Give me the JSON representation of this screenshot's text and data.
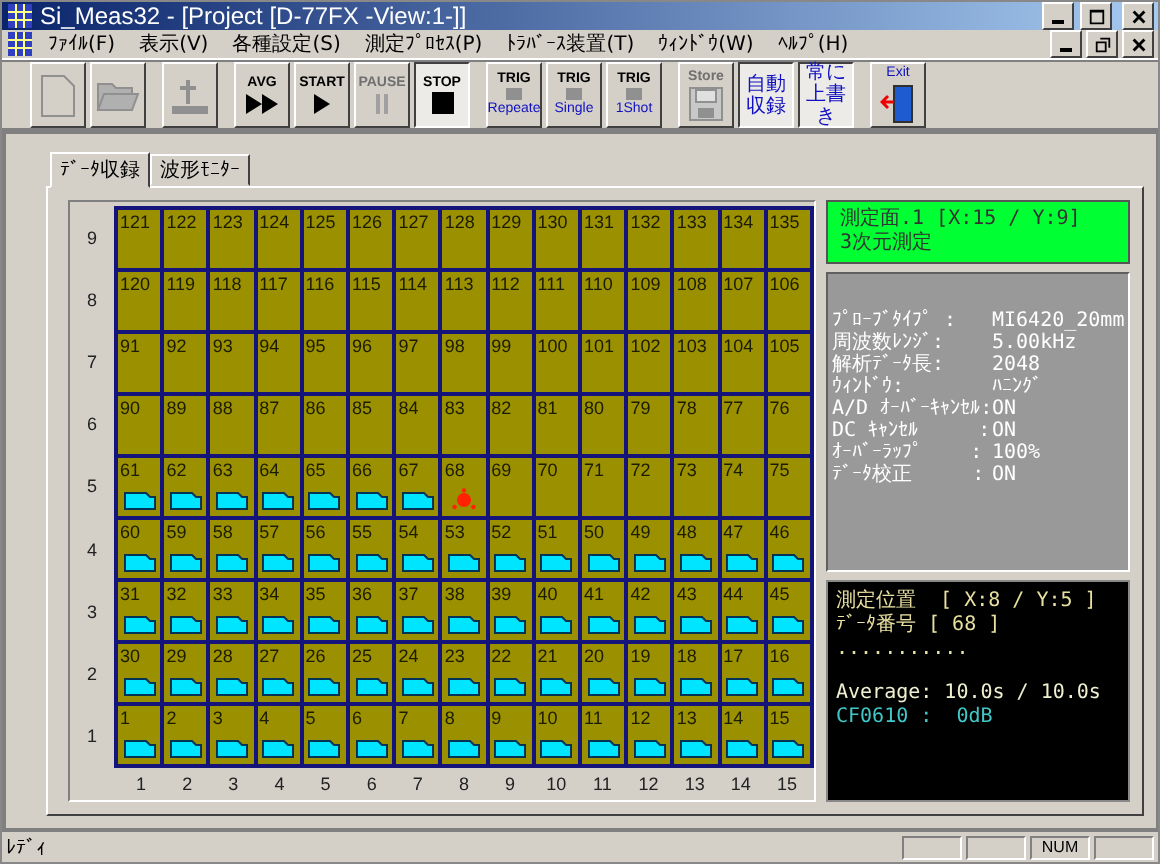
{
  "window": {
    "title": "Si_Meas32 - [Project [D-77FX  -View:1-]]"
  },
  "menu": [
    "ﾌｧｲﾙ(F)",
    "表示(V)",
    "各種設定(S)",
    "測定ﾌﾟﾛｾｽ(P)",
    "ﾄﾗﾊﾞｰｽ装置(T)",
    "ｳｨﾝﾄﾞｳ(W)",
    "ﾍﾙﾌﾟ(H)"
  ],
  "toolbar": [
    {
      "kind": "new",
      "disabled": true,
      "pressed": false
    },
    {
      "kind": "open",
      "disabled": true,
      "pressed": false
    },
    {
      "kind": "stage",
      "disabled": true,
      "pressed": false
    },
    {
      "kind": "avg",
      "label": "AVG",
      "disabled": false,
      "pressed": false
    },
    {
      "kind": "start",
      "label": "START",
      "disabled": false,
      "pressed": false
    },
    {
      "kind": "pause",
      "label": "PAUSE",
      "disabled": true,
      "pressed": false
    },
    {
      "kind": "stop",
      "label": "STOP",
      "disabled": false,
      "pressed": true
    },
    {
      "kind": "trig",
      "label": "TRIG",
      "sub": "Repeate",
      "disabled": false,
      "pressed": false
    },
    {
      "kind": "trig",
      "label": "TRIG",
      "sub": "Single",
      "disabled": false,
      "pressed": false
    },
    {
      "kind": "trig",
      "label": "TRIG",
      "sub": "1Shot",
      "disabled": false,
      "pressed": false
    },
    {
      "kind": "store",
      "label": "Store",
      "disabled": true,
      "pressed": false
    },
    {
      "kind": "text",
      "label": "自動収録",
      "disabled": false,
      "pressed": true
    },
    {
      "kind": "text",
      "label": "常に上書き",
      "disabled": false,
      "pressed": true
    },
    {
      "kind": "exit",
      "label": "Exit",
      "disabled": false,
      "pressed": false
    }
  ],
  "tabs": [
    {
      "label": "ﾃﾞｰﾀ収録",
      "selected": true
    },
    {
      "label": "波形ﾓﾆﾀｰ",
      "selected": false
    }
  ],
  "grid": {
    "rows": [
      {
        "y_label": "9",
        "cells": [
          {
            "label": "121",
            "kind": "empty"
          },
          {
            "label": "122",
            "kind": "empty"
          },
          {
            "label": "123",
            "kind": "empty"
          },
          {
            "label": "124",
            "kind": "empty"
          },
          {
            "label": "125",
            "kind": "empty"
          },
          {
            "label": "126",
            "kind": "empty"
          },
          {
            "label": "127",
            "kind": "empty"
          },
          {
            "label": "128",
            "kind": "empty"
          },
          {
            "label": "129",
            "kind": "empty"
          },
          {
            "label": "130",
            "kind": "empty"
          },
          {
            "label": "131",
            "kind": "empty"
          },
          {
            "label": "132",
            "kind": "empty"
          },
          {
            "label": "133",
            "kind": "empty"
          },
          {
            "label": "134",
            "kind": "empty"
          },
          {
            "label": "135",
            "kind": "empty"
          }
        ]
      },
      {
        "y_label": "8",
        "cells": [
          {
            "label": "120",
            "kind": "empty"
          },
          {
            "label": "119",
            "kind": "empty"
          },
          {
            "label": "118",
            "kind": "empty"
          },
          {
            "label": "117",
            "kind": "empty"
          },
          {
            "label": "116",
            "kind": "empty"
          },
          {
            "label": "115",
            "kind": "empty"
          },
          {
            "label": "114",
            "kind": "empty"
          },
          {
            "label": "113",
            "kind": "empty"
          },
          {
            "label": "112",
            "kind": "empty"
          },
          {
            "label": "111",
            "kind": "empty"
          },
          {
            "label": "110",
            "kind": "empty"
          },
          {
            "label": "109",
            "kind": "empty"
          },
          {
            "label": "108",
            "kind": "empty"
          },
          {
            "label": "107",
            "kind": "empty"
          },
          {
            "label": "106",
            "kind": "empty"
          }
        ]
      },
      {
        "y_label": "7",
        "cells": [
          {
            "label": "91",
            "kind": "empty"
          },
          {
            "label": "92",
            "kind": "empty"
          },
          {
            "label": "93",
            "kind": "empty"
          },
          {
            "label": "94",
            "kind": "empty"
          },
          {
            "label": "95",
            "kind": "empty"
          },
          {
            "label": "96",
            "kind": "empty"
          },
          {
            "label": "97",
            "kind": "empty"
          },
          {
            "label": "98",
            "kind": "empty"
          },
          {
            "label": "99",
            "kind": "empty"
          },
          {
            "label": "100",
            "kind": "empty"
          },
          {
            "label": "101",
            "kind": "empty"
          },
          {
            "label": "102",
            "kind": "empty"
          },
          {
            "label": "103",
            "kind": "empty"
          },
          {
            "label": "104",
            "kind": "empty"
          },
          {
            "label": "105",
            "kind": "empty"
          }
        ]
      },
      {
        "y_label": "6",
        "cells": [
          {
            "label": "90",
            "kind": "empty"
          },
          {
            "label": "89",
            "kind": "empty"
          },
          {
            "label": "88",
            "kind": "empty"
          },
          {
            "label": "87",
            "kind": "empty"
          },
          {
            "label": "86",
            "kind": "empty"
          },
          {
            "label": "85",
            "kind": "empty"
          },
          {
            "label": "84",
            "kind": "empty"
          },
          {
            "label": "83",
            "kind": "empty"
          },
          {
            "label": "82",
            "kind": "empty"
          },
          {
            "label": "81",
            "kind": "empty"
          },
          {
            "label": "80",
            "kind": "empty"
          },
          {
            "label": "79",
            "kind": "empty"
          },
          {
            "label": "78",
            "kind": "empty"
          },
          {
            "label": "77",
            "kind": "empty"
          },
          {
            "label": "76",
            "kind": "empty"
          }
        ]
      },
      {
        "y_label": "5",
        "cells": [
          {
            "label": "61",
            "kind": "recorded"
          },
          {
            "label": "62",
            "kind": "recorded"
          },
          {
            "label": "63",
            "kind": "recorded"
          },
          {
            "label": "64",
            "kind": "recorded"
          },
          {
            "label": "65",
            "kind": "recorded"
          },
          {
            "label": "66",
            "kind": "recorded"
          },
          {
            "label": "67",
            "kind": "recorded"
          },
          {
            "label": "68",
            "kind": "current"
          },
          {
            "label": "69",
            "kind": "empty"
          },
          {
            "label": "70",
            "kind": "empty"
          },
          {
            "label": "71",
            "kind": "empty"
          },
          {
            "label": "72",
            "kind": "empty"
          },
          {
            "label": "73",
            "kind": "empty"
          },
          {
            "label": "74",
            "kind": "empty"
          },
          {
            "label": "75",
            "kind": "empty"
          }
        ]
      },
      {
        "y_label": "4",
        "cells": [
          {
            "label": "60",
            "kind": "recorded"
          },
          {
            "label": "59",
            "kind": "recorded"
          },
          {
            "label": "58",
            "kind": "recorded"
          },
          {
            "label": "57",
            "kind": "recorded"
          },
          {
            "label": "56",
            "kind": "recorded"
          },
          {
            "label": "55",
            "kind": "recorded"
          },
          {
            "label": "54",
            "kind": "recorded"
          },
          {
            "label": "53",
            "kind": "recorded"
          },
          {
            "label": "52",
            "kind": "recorded"
          },
          {
            "label": "51",
            "kind": "recorded"
          },
          {
            "label": "50",
            "kind": "recorded"
          },
          {
            "label": "49",
            "kind": "recorded"
          },
          {
            "label": "48",
            "kind": "recorded"
          },
          {
            "label": "47",
            "kind": "recorded"
          },
          {
            "label": "46",
            "kind": "recorded"
          }
        ]
      },
      {
        "y_label": "3",
        "cells": [
          {
            "label": "31",
            "kind": "recorded"
          },
          {
            "label": "32",
            "kind": "recorded"
          },
          {
            "label": "33",
            "kind": "recorded"
          },
          {
            "label": "34",
            "kind": "recorded"
          },
          {
            "label": "35",
            "kind": "recorded"
          },
          {
            "label": "36",
            "kind": "recorded"
          },
          {
            "label": "37",
            "kind": "recorded"
          },
          {
            "label": "38",
            "kind": "recorded"
          },
          {
            "label": "39",
            "kind": "recorded"
          },
          {
            "label": "40",
            "kind": "recorded"
          },
          {
            "label": "41",
            "kind": "recorded"
          },
          {
            "label": "42",
            "kind": "recorded"
          },
          {
            "label": "43",
            "kind": "recorded"
          },
          {
            "label": "44",
            "kind": "recorded"
          },
          {
            "label": "45",
            "kind": "recorded"
          }
        ]
      },
      {
        "y_label": "2",
        "cells": [
          {
            "label": "30",
            "kind": "recorded"
          },
          {
            "label": "29",
            "kind": "recorded"
          },
          {
            "label": "28",
            "kind": "recorded"
          },
          {
            "label": "27",
            "kind": "recorded"
          },
          {
            "label": "26",
            "kind": "recorded"
          },
          {
            "label": "25",
            "kind": "recorded"
          },
          {
            "label": "24",
            "kind": "recorded"
          },
          {
            "label": "23",
            "kind": "recorded"
          },
          {
            "label": "22",
            "kind": "recorded"
          },
          {
            "label": "21",
            "kind": "recorded"
          },
          {
            "label": "20",
            "kind": "recorded"
          },
          {
            "label": "19",
            "kind": "recorded"
          },
          {
            "label": "18",
            "kind": "recorded"
          },
          {
            "label": "17",
            "kind": "recorded"
          },
          {
            "label": "16",
            "kind": "recorded"
          }
        ]
      },
      {
        "y_label": "1",
        "cells": [
          {
            "label": "1",
            "kind": "recorded"
          },
          {
            "label": "2",
            "kind": "recorded"
          },
          {
            "label": "3",
            "kind": "recorded"
          },
          {
            "label": "4",
            "kind": "recorded"
          },
          {
            "label": "5",
            "kind": "recorded"
          },
          {
            "label": "6",
            "kind": "recorded"
          },
          {
            "label": "7",
            "kind": "recorded"
          },
          {
            "label": "8",
            "kind": "recorded"
          },
          {
            "label": "9",
            "kind": "recorded"
          },
          {
            "label": "10",
            "kind": "recorded"
          },
          {
            "label": "11",
            "kind": "recorded"
          },
          {
            "label": "12",
            "kind": "recorded"
          },
          {
            "label": "13",
            "kind": "recorded"
          },
          {
            "label": "14",
            "kind": "recorded"
          },
          {
            "label": "15",
            "kind": "recorded"
          }
        ]
      }
    ],
    "x_labels": [
      "1",
      "2",
      "3",
      "4",
      "5",
      "6",
      "7",
      "8",
      "9",
      "10",
      "11",
      "12",
      "13",
      "14",
      "15"
    ]
  },
  "plane_panel": {
    "lines": [
      "測定面.1 [X:15 / Y:9]",
      "3次元測定"
    ]
  },
  "settings_panel": {
    "rows": [
      {
        "label": "ﾌﾟﾛｰﾌﾞﾀｲﾌﾟ :",
        "value": "MI6420_20mm"
      },
      {
        "label": "周波数ﾚﾝｼﾞ:",
        "value": "5.00kHz"
      },
      {
        "label": "解析ﾃﾞｰﾀ長:",
        "value": "2048"
      },
      {
        "label": "ｳｨﾝﾄﾞｳ:",
        "value": "ﾊﾆﾝｸﾞ"
      },
      {
        "label": "A/D ｵｰﾊﾞｰｷｬﾝｾﾙ:",
        "value": "ON"
      },
      {
        "label": "DC ｷｬﾝｾﾙ     :",
        "value": "ON"
      },
      {
        "label": "ｵｰﾊﾞｰﾗｯﾌﾟ    :",
        "value": "100%"
      },
      {
        "label": "ﾃﾞｰﾀ校正     :",
        "value": "ON"
      }
    ]
  },
  "status_panel": {
    "lines": [
      {
        "text": "測定位置  [ X:8 / Y:5 ]",
        "kind": "header"
      },
      {
        "text": "ﾃﾞｰﾀ番号 [ 68 ]",
        "kind": "header"
      },
      {
        "text": "...........",
        "kind": "header"
      },
      {
        "text": "Average: 10.0s / 10.0s",
        "kind": "normal"
      },
      {
        "text": "CF0610 :  0dB",
        "kind": "channel"
      }
    ]
  },
  "status_bar": {
    "text": "ﾚﾃﾞｨ",
    "indicators": [
      "NUM"
    ]
  }
}
